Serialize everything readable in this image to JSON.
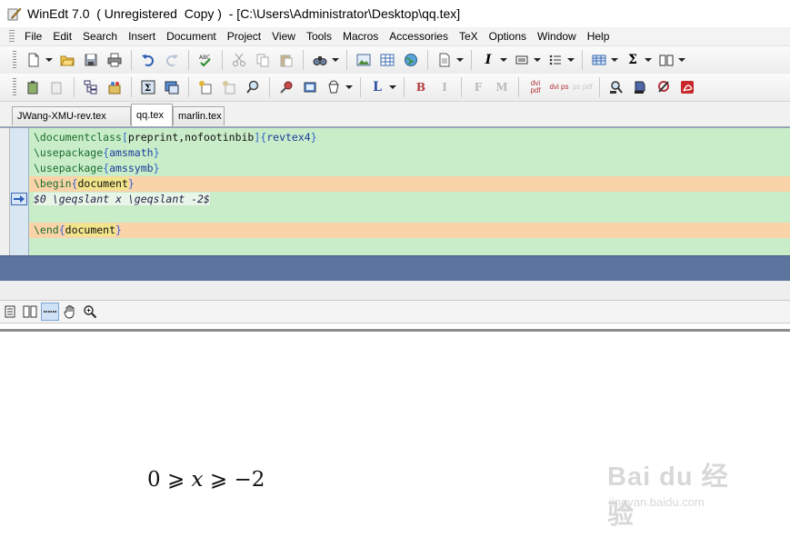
{
  "window": {
    "title": "WinEdt 7.0  ( Unregistered  Copy )  - [C:\\Users\\Administrator\\Desktop\\qq.tex]"
  },
  "menu": [
    "File",
    "Edit",
    "Search",
    "Insert",
    "Document",
    "Project",
    "View",
    "Tools",
    "Macros",
    "Accessories",
    "TeX",
    "Options",
    "Window",
    "Help"
  ],
  "toolbar": {
    "italic_label": "I",
    "sum_label": "Σ",
    "l_label": "L",
    "bold_label": "B",
    "italic2_label": "I",
    "f_label": "F",
    "m_label": "M",
    "dvipdf_label": "dvi pdf",
    "dvips_label": "dvi ps",
    "pspdf_label": "ps pdf"
  },
  "tabs": [
    "JWang-XMU-rev.tex",
    "qq.tex",
    "marlin.tex"
  ],
  "editor": {
    "lines": [
      {
        "cmd": "\\documentclass",
        "o1": "[",
        "a1": "preprint,nofootinbib",
        "c1": "]",
        "o2": "{",
        "a2": "revtex4",
        "c2": "}"
      },
      {
        "cmd": "\\usepackage",
        "o1": "{",
        "a1": "amsmath",
        "c1": "}"
      },
      {
        "cmd": "\\usepackage",
        "o1": "{",
        "a1": "amssymb",
        "c1": "}"
      },
      {
        "cmd": "\\begin",
        "o1": "{",
        "a1": "document",
        "c1": "}"
      },
      {
        "math": "$0 \\geqslant x \\geqslant -2$"
      },
      {
        "cmd": "\\end",
        "o1": "{",
        "a1": "document",
        "c1": "}"
      }
    ]
  },
  "preview": {
    "formula": {
      "n0": "0",
      "rel1": "⩾",
      "var": "x",
      "rel2": "⩾",
      "rhs": "−2"
    }
  },
  "watermark": {
    "text": "Bai du 经验",
    "url": "jingyan.baidu.com"
  },
  "colors": {
    "editor_bg": "#c9ecc9",
    "highlight_line": "#fbd3a9",
    "blue_band": "#5d759e",
    "command": "#1a6e2e",
    "brace": "#3366cc"
  },
  "icons": [
    "new-file-icon",
    "open-folder-icon",
    "save-icon",
    "print-icon",
    "undo-icon",
    "redo-icon",
    "spellcheck-icon",
    "cut-icon",
    "copy-icon",
    "paste-icon",
    "find-icon",
    "image-icon",
    "table-icon",
    "globe-icon",
    "document-icon",
    "italic-icon",
    "align-icon",
    "list-icon",
    "grid-icon",
    "sum-icon",
    "book-icon",
    "arrow-marker-icon",
    "hand-icon",
    "zoom-icon"
  ]
}
